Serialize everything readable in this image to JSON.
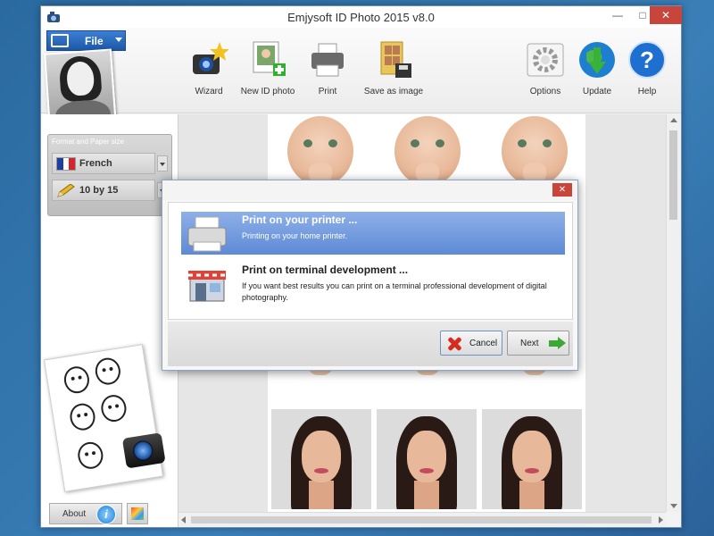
{
  "window": {
    "title": "Emjysoft ID Photo 2015 v8.0",
    "controls": {
      "minimize": "—",
      "maximize": "□",
      "close": "✕"
    }
  },
  "toolbar": {
    "file_label": "File",
    "items": [
      {
        "label": "Wizard",
        "icon": "wizard-camera-icon"
      },
      {
        "label": "New ID photo",
        "icon": "new-photo-icon"
      },
      {
        "label": "Print",
        "icon": "printer-icon"
      },
      {
        "label": "Save as image",
        "icon": "save-image-icon"
      },
      {
        "label": "Options",
        "icon": "gear-icon"
      },
      {
        "label": "Update",
        "icon": "globe-update-icon"
      },
      {
        "label": "Help",
        "icon": "help-icon"
      }
    ]
  },
  "sidebar": {
    "format_title": "Format and Paper size",
    "country": "French",
    "paper": "10 by 15",
    "about_label": "About"
  },
  "dialog": {
    "close": "✕",
    "options": [
      {
        "title": "Print on your printer ...",
        "description": "Printing on your home printer.",
        "selected": true
      },
      {
        "title": "Print on terminal development ...",
        "description": "If you want best results you can print on a terminal professional development of digital photography.",
        "selected": false
      }
    ],
    "cancel_label": "Cancel",
    "next_label": "Next"
  },
  "colors": {
    "selection": "#5d8ad6",
    "file_button": "#1c58a8",
    "close_red": "#c7453a",
    "accent_green": "#3da836"
  }
}
